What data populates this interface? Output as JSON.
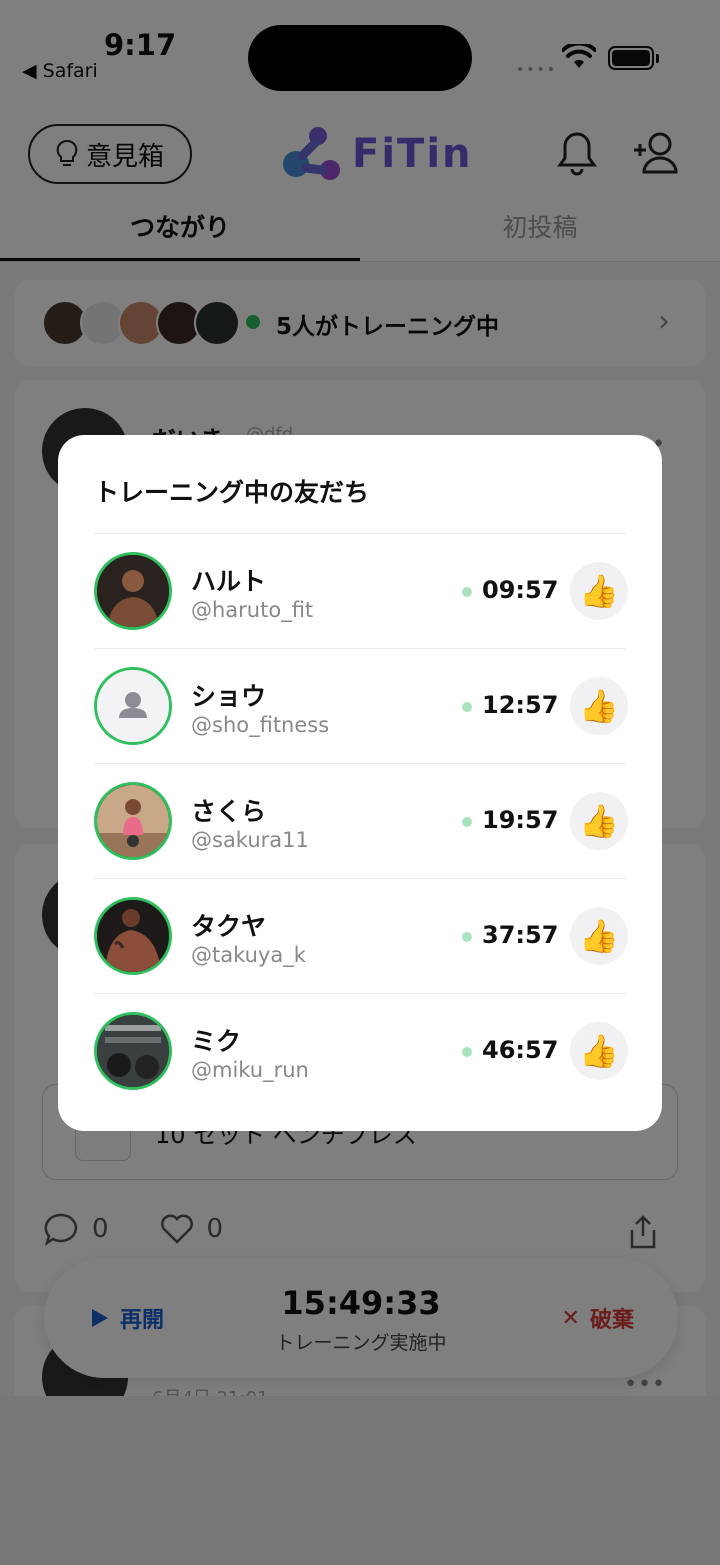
{
  "status": {
    "time": "9:17",
    "back_label": "◀ Safari"
  },
  "header": {
    "feedback_label": "意見箱",
    "logo_text": "FiTin"
  },
  "tabs": [
    {
      "label": "つながり",
      "active": true
    },
    {
      "label": "初投稿",
      "active": false
    }
  ],
  "training_bar": {
    "text": "5人がトレーニング中"
  },
  "posts": [
    {
      "name": "だいき",
      "handle": "@dfd",
      "workout": "10 セット ベンチプレス",
      "comments": "0",
      "likes": "0"
    },
    {
      "time": "6月4日 21:01"
    }
  ],
  "bottom_controls": {
    "resume_label": "再開",
    "timer": "15:49:33",
    "timer_sub": "トレーニング実施中",
    "discard_label": "破棄"
  },
  "modal": {
    "title": "トレーニング中の友だち",
    "friends": [
      {
        "name": "ハルト",
        "handle": "@haruto_fit",
        "elapsed": "09:57",
        "avatar": "photo"
      },
      {
        "name": "ショウ",
        "handle": "@sho_fitness",
        "elapsed": "12:57",
        "avatar": "placeholder"
      },
      {
        "name": "さくら",
        "handle": "@sakura11",
        "elapsed": "19:57",
        "avatar": "photo"
      },
      {
        "name": "タクヤ",
        "handle": "@takuya_k",
        "elapsed": "37:57",
        "avatar": "photo"
      },
      {
        "name": "ミク",
        "handle": "@miku_run",
        "elapsed": "46:57",
        "avatar": "photo"
      }
    ]
  },
  "colors": {
    "online_green": "#2fbf5c",
    "resume_blue": "#1a5fd0",
    "discard_red": "#d63b3b",
    "logo_purple": "#6a5bd6"
  }
}
